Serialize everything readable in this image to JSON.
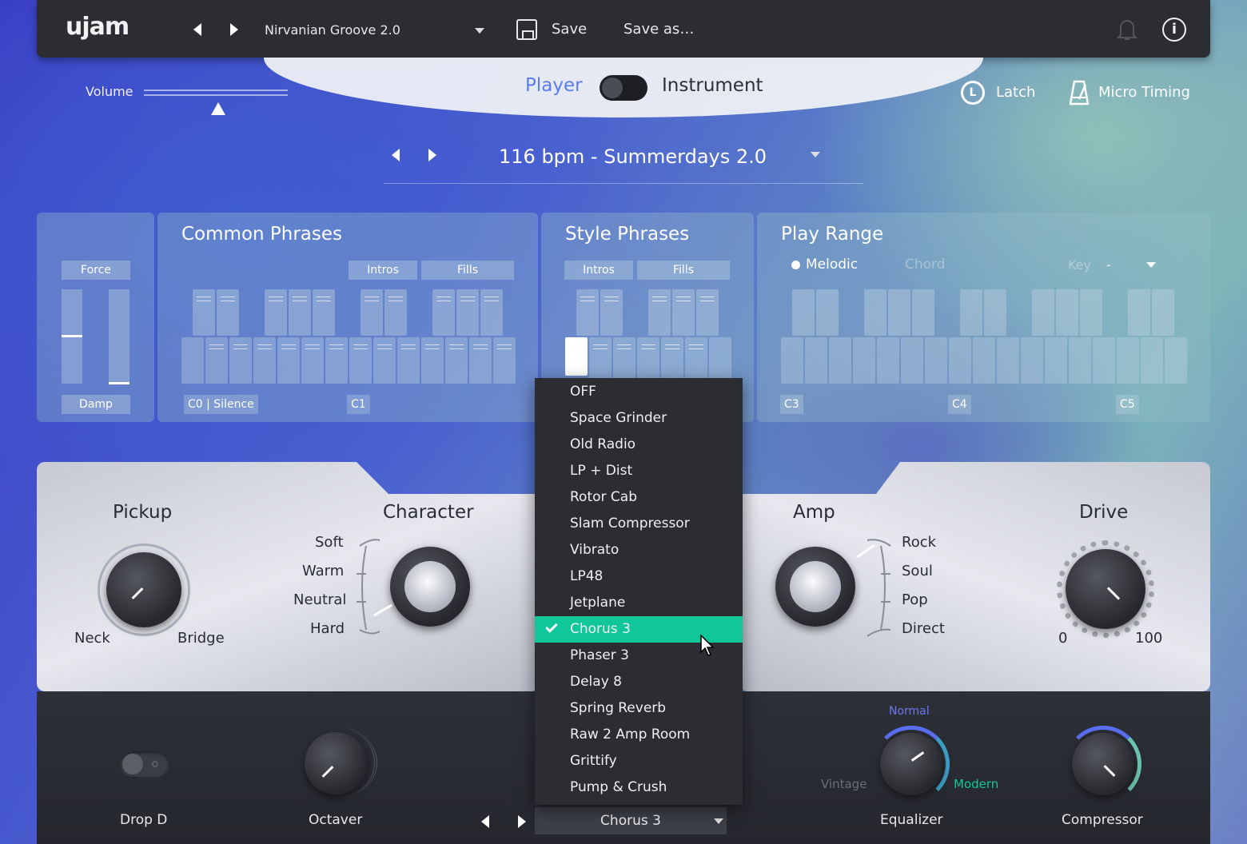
{
  "topbar": {
    "logo": "ujam",
    "preset": "Nirvanian Groove 2.0",
    "save": "Save",
    "save_as": "Save as…",
    "info": "i"
  },
  "header": {
    "volume": "Volume",
    "player": "Player",
    "instrument": "Instrument",
    "latch": "Latch",
    "latch_glyph": "L",
    "micro_timing": "Micro Timing",
    "bpm_style": "116 bpm - Summerdays 2.0"
  },
  "phrases": {
    "force": "Force",
    "damp": "Damp",
    "common_title": "Common Phrases",
    "common_intros": "Intros",
    "common_fills": "Fills",
    "c0_label": "C0 | Silence",
    "c1_label": "C1",
    "style_title": "Style Phrases",
    "style_intros": "Intros",
    "style_fills": "Fills",
    "range_title": "Play Range",
    "melodic": "Melodic",
    "chord": "Chord",
    "key": "Key",
    "key_value": "-",
    "c3": "C3",
    "c4": "C4",
    "c5": "C5"
  },
  "instrument": {
    "pickup": "Pickup",
    "neck": "Neck",
    "bridge": "Bridge",
    "character": "Character",
    "char_options": [
      "Soft",
      "Warm",
      "Neutral",
      "Hard"
    ],
    "amp": "Amp",
    "amp_options": [
      "Rock",
      "Soul",
      "Pop",
      "Direct"
    ],
    "drive": "Drive",
    "drive_min": "0",
    "drive_max": "100"
  },
  "bottom": {
    "drop_d": "Drop D",
    "octaver": "Octaver",
    "normal": "Normal",
    "vintage": "Vintage",
    "modern": "Modern",
    "equalizer": "Equalizer",
    "compressor": "Compressor",
    "fx_value": "Chorus 3"
  },
  "fx_menu": {
    "items": [
      "OFF",
      "Space Grinder",
      "Old Radio",
      "LP + Dist",
      "Rotor Cab",
      "Slam Compressor",
      "Vibrato",
      "LP48",
      "Jetplane",
      "Chorus 3",
      "Phaser 3",
      "Delay 8",
      "Spring Reverb",
      "Raw 2 Amp Room",
      "Grittify",
      "Pump & Crush"
    ],
    "selected": "Chorus 3"
  },
  "colors": {
    "accent": "#11c79a",
    "player_blue": "#5a7cf0"
  }
}
